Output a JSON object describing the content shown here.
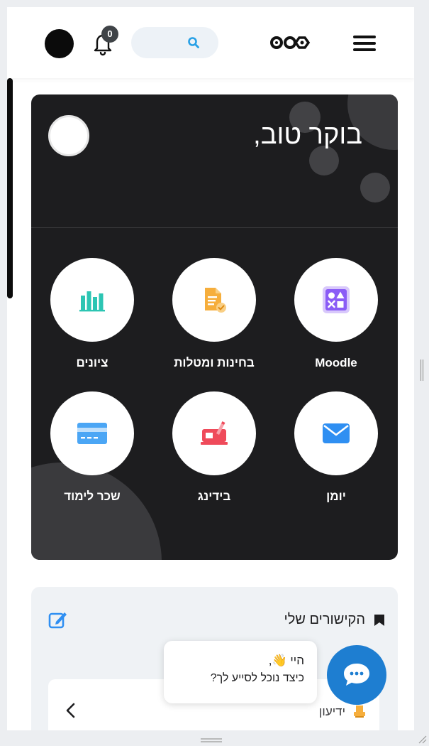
{
  "header": {
    "notifications_count": "0",
    "search_placeholder": "",
    "menu_icon": "hamburger-icon",
    "logo_icon": "logo-icon"
  },
  "greeting": {
    "text": "בוקר טוב,"
  },
  "tiles": [
    {
      "label": "Moodle",
      "icon": "moodle-icon",
      "color": "#8a5cf6"
    },
    {
      "label": "בחינות ומטלות",
      "icon": "document-check-icon",
      "color": "#f6ae3c"
    },
    {
      "label": "ציונים",
      "icon": "bar-chart-icon",
      "color": "#2cc5b3"
    },
    {
      "label": "יומן",
      "icon": "mail-icon",
      "color": "#2f8ff2"
    },
    {
      "label": "בידינג",
      "icon": "bidding-icon",
      "color": "#ef4a5a"
    },
    {
      "label": "שכר לימוד",
      "icon": "credit-card-icon",
      "color": "#4ba6f5"
    }
  ],
  "links": {
    "title": "הקישורים שלי",
    "items": [
      {
        "label": "ידיעון",
        "icon": "book-icon"
      }
    ]
  },
  "chat": {
    "line1": "היי 👋,",
    "line2": "כיצד נוכל לסייע לך?"
  },
  "colors": {
    "card_bg": "#1d1d1f",
    "accent_blue": "#1e7ed1",
    "page_bg": "#eceef1"
  }
}
